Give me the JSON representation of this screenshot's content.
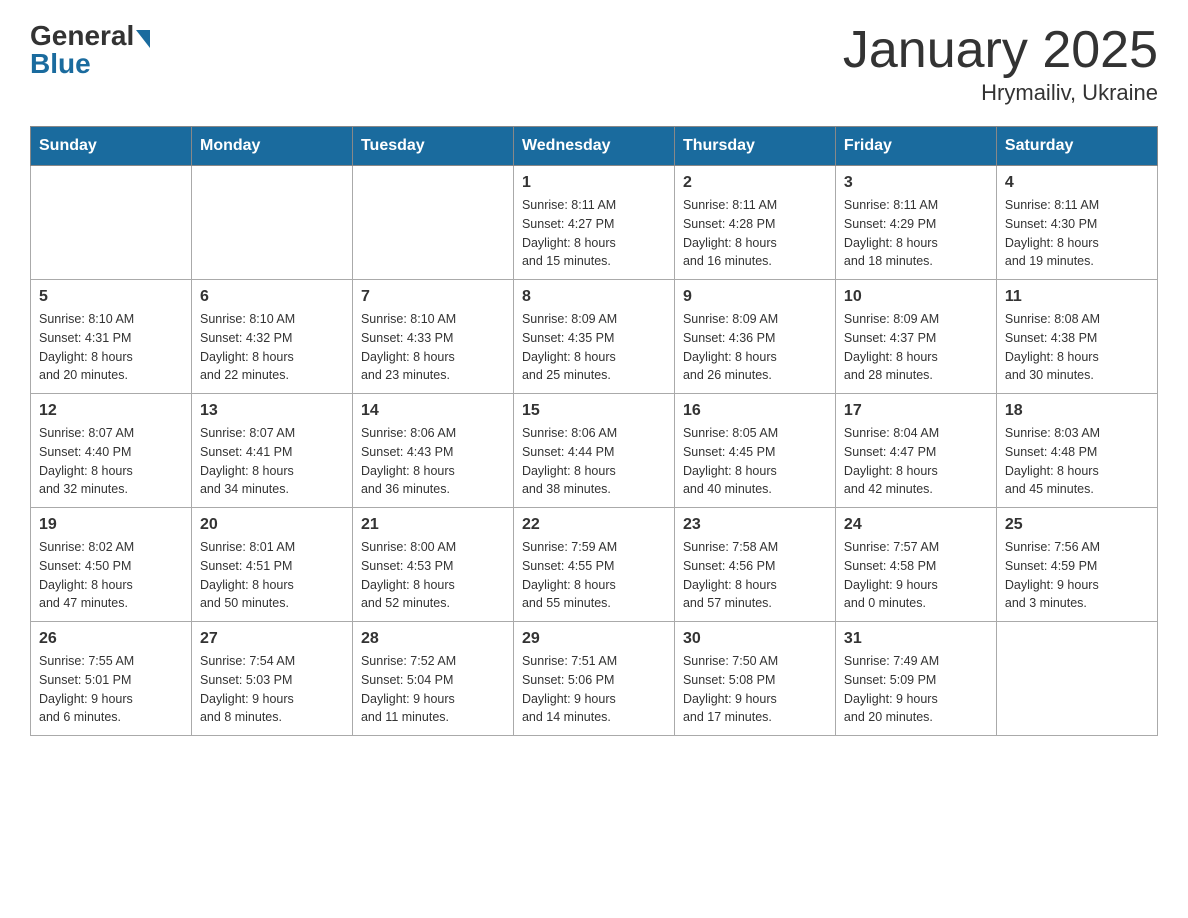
{
  "header": {
    "logo_general": "General",
    "logo_blue": "Blue",
    "title": "January 2025",
    "subtitle": "Hrymailiv, Ukraine"
  },
  "days_of_week": [
    "Sunday",
    "Monday",
    "Tuesday",
    "Wednesday",
    "Thursday",
    "Friday",
    "Saturday"
  ],
  "weeks": [
    [
      {
        "day": "",
        "info": ""
      },
      {
        "day": "",
        "info": ""
      },
      {
        "day": "",
        "info": ""
      },
      {
        "day": "1",
        "info": "Sunrise: 8:11 AM\nSunset: 4:27 PM\nDaylight: 8 hours\nand 15 minutes."
      },
      {
        "day": "2",
        "info": "Sunrise: 8:11 AM\nSunset: 4:28 PM\nDaylight: 8 hours\nand 16 minutes."
      },
      {
        "day": "3",
        "info": "Sunrise: 8:11 AM\nSunset: 4:29 PM\nDaylight: 8 hours\nand 18 minutes."
      },
      {
        "day": "4",
        "info": "Sunrise: 8:11 AM\nSunset: 4:30 PM\nDaylight: 8 hours\nand 19 minutes."
      }
    ],
    [
      {
        "day": "5",
        "info": "Sunrise: 8:10 AM\nSunset: 4:31 PM\nDaylight: 8 hours\nand 20 minutes."
      },
      {
        "day": "6",
        "info": "Sunrise: 8:10 AM\nSunset: 4:32 PM\nDaylight: 8 hours\nand 22 minutes."
      },
      {
        "day": "7",
        "info": "Sunrise: 8:10 AM\nSunset: 4:33 PM\nDaylight: 8 hours\nand 23 minutes."
      },
      {
        "day": "8",
        "info": "Sunrise: 8:09 AM\nSunset: 4:35 PM\nDaylight: 8 hours\nand 25 minutes."
      },
      {
        "day": "9",
        "info": "Sunrise: 8:09 AM\nSunset: 4:36 PM\nDaylight: 8 hours\nand 26 minutes."
      },
      {
        "day": "10",
        "info": "Sunrise: 8:09 AM\nSunset: 4:37 PM\nDaylight: 8 hours\nand 28 minutes."
      },
      {
        "day": "11",
        "info": "Sunrise: 8:08 AM\nSunset: 4:38 PM\nDaylight: 8 hours\nand 30 minutes."
      }
    ],
    [
      {
        "day": "12",
        "info": "Sunrise: 8:07 AM\nSunset: 4:40 PM\nDaylight: 8 hours\nand 32 minutes."
      },
      {
        "day": "13",
        "info": "Sunrise: 8:07 AM\nSunset: 4:41 PM\nDaylight: 8 hours\nand 34 minutes."
      },
      {
        "day": "14",
        "info": "Sunrise: 8:06 AM\nSunset: 4:43 PM\nDaylight: 8 hours\nand 36 minutes."
      },
      {
        "day": "15",
        "info": "Sunrise: 8:06 AM\nSunset: 4:44 PM\nDaylight: 8 hours\nand 38 minutes."
      },
      {
        "day": "16",
        "info": "Sunrise: 8:05 AM\nSunset: 4:45 PM\nDaylight: 8 hours\nand 40 minutes."
      },
      {
        "day": "17",
        "info": "Sunrise: 8:04 AM\nSunset: 4:47 PM\nDaylight: 8 hours\nand 42 minutes."
      },
      {
        "day": "18",
        "info": "Sunrise: 8:03 AM\nSunset: 4:48 PM\nDaylight: 8 hours\nand 45 minutes."
      }
    ],
    [
      {
        "day": "19",
        "info": "Sunrise: 8:02 AM\nSunset: 4:50 PM\nDaylight: 8 hours\nand 47 minutes."
      },
      {
        "day": "20",
        "info": "Sunrise: 8:01 AM\nSunset: 4:51 PM\nDaylight: 8 hours\nand 50 minutes."
      },
      {
        "day": "21",
        "info": "Sunrise: 8:00 AM\nSunset: 4:53 PM\nDaylight: 8 hours\nand 52 minutes."
      },
      {
        "day": "22",
        "info": "Sunrise: 7:59 AM\nSunset: 4:55 PM\nDaylight: 8 hours\nand 55 minutes."
      },
      {
        "day": "23",
        "info": "Sunrise: 7:58 AM\nSunset: 4:56 PM\nDaylight: 8 hours\nand 57 minutes."
      },
      {
        "day": "24",
        "info": "Sunrise: 7:57 AM\nSunset: 4:58 PM\nDaylight: 9 hours\nand 0 minutes."
      },
      {
        "day": "25",
        "info": "Sunrise: 7:56 AM\nSunset: 4:59 PM\nDaylight: 9 hours\nand 3 minutes."
      }
    ],
    [
      {
        "day": "26",
        "info": "Sunrise: 7:55 AM\nSunset: 5:01 PM\nDaylight: 9 hours\nand 6 minutes."
      },
      {
        "day": "27",
        "info": "Sunrise: 7:54 AM\nSunset: 5:03 PM\nDaylight: 9 hours\nand 8 minutes."
      },
      {
        "day": "28",
        "info": "Sunrise: 7:52 AM\nSunset: 5:04 PM\nDaylight: 9 hours\nand 11 minutes."
      },
      {
        "day": "29",
        "info": "Sunrise: 7:51 AM\nSunset: 5:06 PM\nDaylight: 9 hours\nand 14 minutes."
      },
      {
        "day": "30",
        "info": "Sunrise: 7:50 AM\nSunset: 5:08 PM\nDaylight: 9 hours\nand 17 minutes."
      },
      {
        "day": "31",
        "info": "Sunrise: 7:49 AM\nSunset: 5:09 PM\nDaylight: 9 hours\nand 20 minutes."
      },
      {
        "day": "",
        "info": ""
      }
    ]
  ]
}
